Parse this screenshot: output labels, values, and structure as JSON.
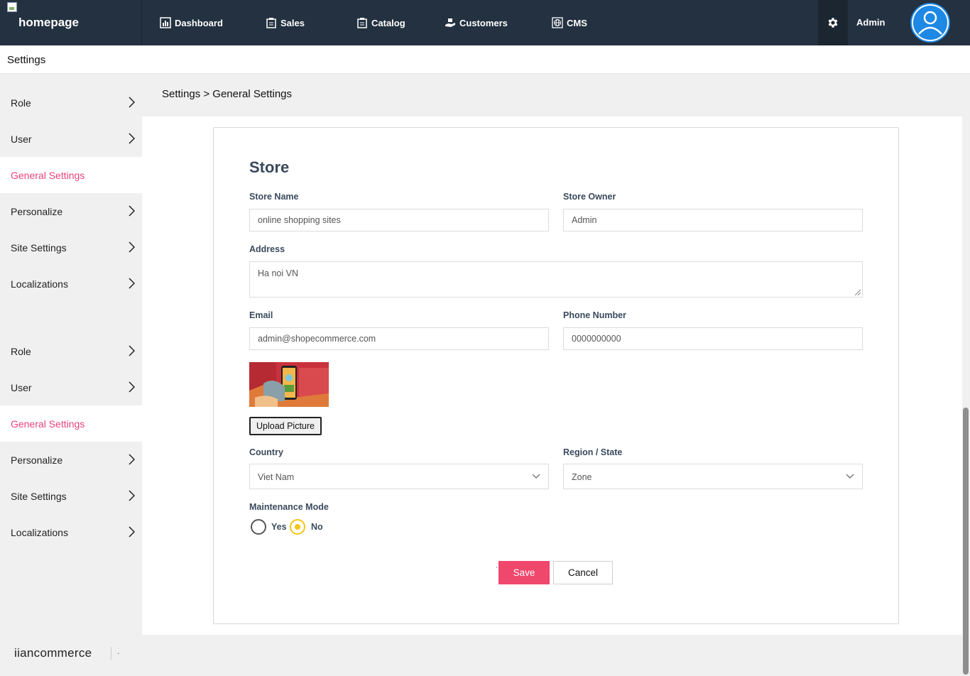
{
  "nav": {
    "logo_alt": "homepage",
    "items": [
      {
        "label": "Dashboard",
        "icon": "dashboard-icon"
      },
      {
        "label": "Sales",
        "icon": "clipboard-icon"
      },
      {
        "label": "Catalog",
        "icon": "clipboard-icon"
      },
      {
        "label": "Customers",
        "icon": "hand-box-icon"
      },
      {
        "label": "CMS",
        "icon": "globe-icon"
      }
    ],
    "user_name": "Admin"
  },
  "page": {
    "title": "Settings",
    "breadcrumb": "Settings > General Settings"
  },
  "sidebar": {
    "items": [
      {
        "label": "Role",
        "active": false,
        "has_chevron": true
      },
      {
        "label": "User",
        "active": false,
        "has_chevron": true
      },
      {
        "label": "General Settings",
        "active": true,
        "has_chevron": false
      },
      {
        "label": "Personalize",
        "active": false,
        "has_chevron": true
      },
      {
        "label": "Site Settings",
        "active": false,
        "has_chevron": true
      },
      {
        "label": "Localizations",
        "active": false,
        "has_chevron": true
      },
      {
        "label": "Role",
        "active": false,
        "has_chevron": true
      },
      {
        "label": "User",
        "active": false,
        "has_chevron": true
      },
      {
        "label": "General Settings",
        "active": true,
        "has_chevron": false
      },
      {
        "label": "Personalize",
        "active": false,
        "has_chevron": true
      },
      {
        "label": "Site Settings",
        "active": false,
        "has_chevron": true
      },
      {
        "label": "Localizations",
        "active": false,
        "has_chevron": true
      }
    ]
  },
  "form": {
    "section_title": "Store",
    "store_name_label": "Store Name",
    "store_name_value": "online shopping sites",
    "store_owner_label": "Store Owner",
    "store_owner_value": "Admin",
    "address_label": "Address",
    "address_value": "Ha noi VN",
    "email_label": "Email",
    "email_value": "admin@shopecommerce.com",
    "phone_label": "Phone Number",
    "phone_value": "0000000000",
    "upload_label": "Upload Picture",
    "country_label": "Country",
    "country_value": "Viet Nam",
    "region_label": "Region / State",
    "region_value": "Zone",
    "maintenance_label": "Maintenance Mode",
    "maintenance_yes": "Yes",
    "maintenance_no": "No",
    "maintenance_selected": "No",
    "save_label": "Save",
    "cancel_label": "Cancel",
    "stray_mark": "`"
  },
  "footer": {
    "brand": "iiancommerce",
    "suffix": "."
  },
  "colors": {
    "nav_bg": "#233140",
    "accent_pink": "#e8437a",
    "save_bg": "#f0476d",
    "radio_selected": "#f5c518",
    "avatar_blue": "#1e88e5"
  }
}
